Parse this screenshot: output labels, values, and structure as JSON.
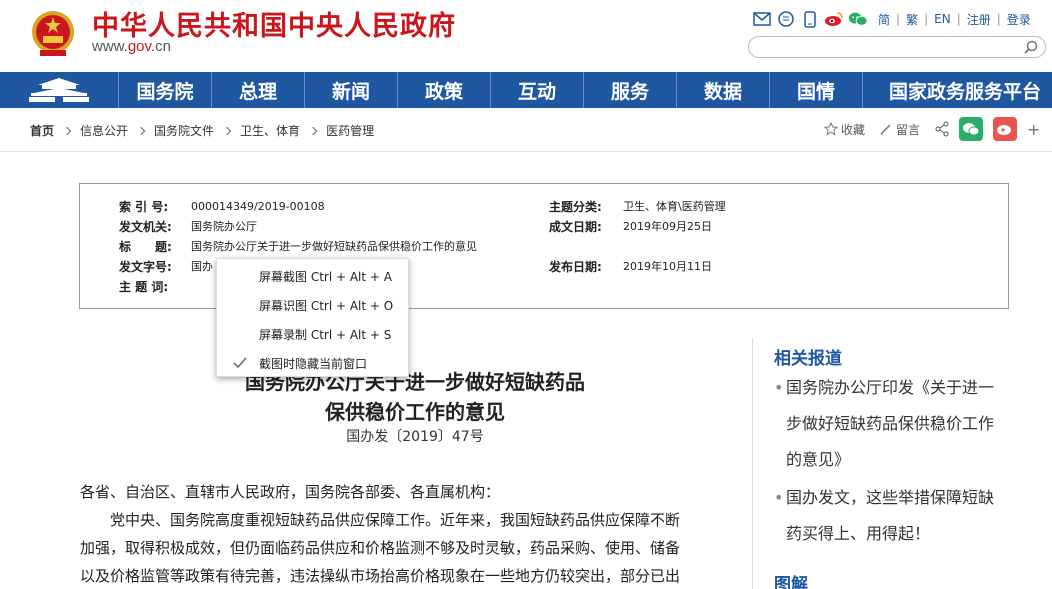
{
  "header": {
    "site_title": "中华人民共和国中央人民政府",
    "domain_prefix": "www.",
    "domain_main": "gov",
    "domain_suffix": ".cn",
    "tools": {
      "simplified": "简",
      "traditional": "繁",
      "english": "EN",
      "register": "注册",
      "login": "登录",
      "sep": "|"
    },
    "search_placeholder": ""
  },
  "nav": {
    "items": [
      "国务院",
      "总理",
      "新闻",
      "政策",
      "互动",
      "服务",
      "数据",
      "国情",
      "国家政务服务平台"
    ],
    "color": "#1f57a1"
  },
  "breadcrumb": {
    "items": [
      "首页",
      "信息公开",
      "国务院文件",
      "卫生、体育",
      "医药管理"
    ]
  },
  "share": {
    "favorite": "收藏",
    "comment": "留言",
    "plus": "+"
  },
  "info": {
    "index_label": "索 引 号:",
    "index_value": "000014349/2019-00108",
    "topic_label": "主题分类:",
    "topic_value": "卫生、体育\\医药管理",
    "issuer_label": "发文机关:",
    "issuer_value": "国务院办公厅",
    "date_label": "成文日期:",
    "date_value": "2019年09月25日",
    "title_label": "标　　题:",
    "title_value": "国务院办公厅关于进一步做好短缺药品保供稳价工作的意见",
    "docno_label": "发文字号:",
    "docno_value": "国办",
    "pubdate_label": "发布日期:",
    "pubdate_value": "2019年10月11日",
    "keywords_label": "主 题 词:"
  },
  "context_menu": {
    "items": [
      "屏幕截图 Ctrl + Alt + A",
      "屏幕识图 Ctrl + Alt + O",
      "屏幕录制 Ctrl + Alt + S",
      "截图时隐藏当前窗口"
    ]
  },
  "article": {
    "title_line1": "国务院办公厅关于进一步做好短缺药品",
    "title_line2": "保供稳价工作的意见",
    "doc_number": "国办发〔2019〕47号",
    "salutation": "各省、自治区、直辖市人民政府，国务院各部委、各直属机构：",
    "para1_line1": "　　党中央、国务院高度重视短缺药品供应保障工作。近年来，我国短缺药品供应保障不断",
    "para1_line2": "加强，取得积极成效，但仍面临药品供应和价格监测不够及时灵敏，药品采购、使用、储备",
    "para1_line3": "以及价格监管等政策有待完善，违法操纵市场抬高价格现象在一些地方仍较突出，部分已出"
  },
  "sidebar": {
    "related_title": "相关报道",
    "item1_line1": "国务院办公厅印发《关于进一",
    "item1_line2": "步做好短缺药品保供稳价工作",
    "item1_line3": "的意见》",
    "item2_line1": "国办发文，这些举措保障短缺",
    "item2_line2": "药买得上、用得起！",
    "bullet": "•",
    "graphic_title": "图解"
  }
}
